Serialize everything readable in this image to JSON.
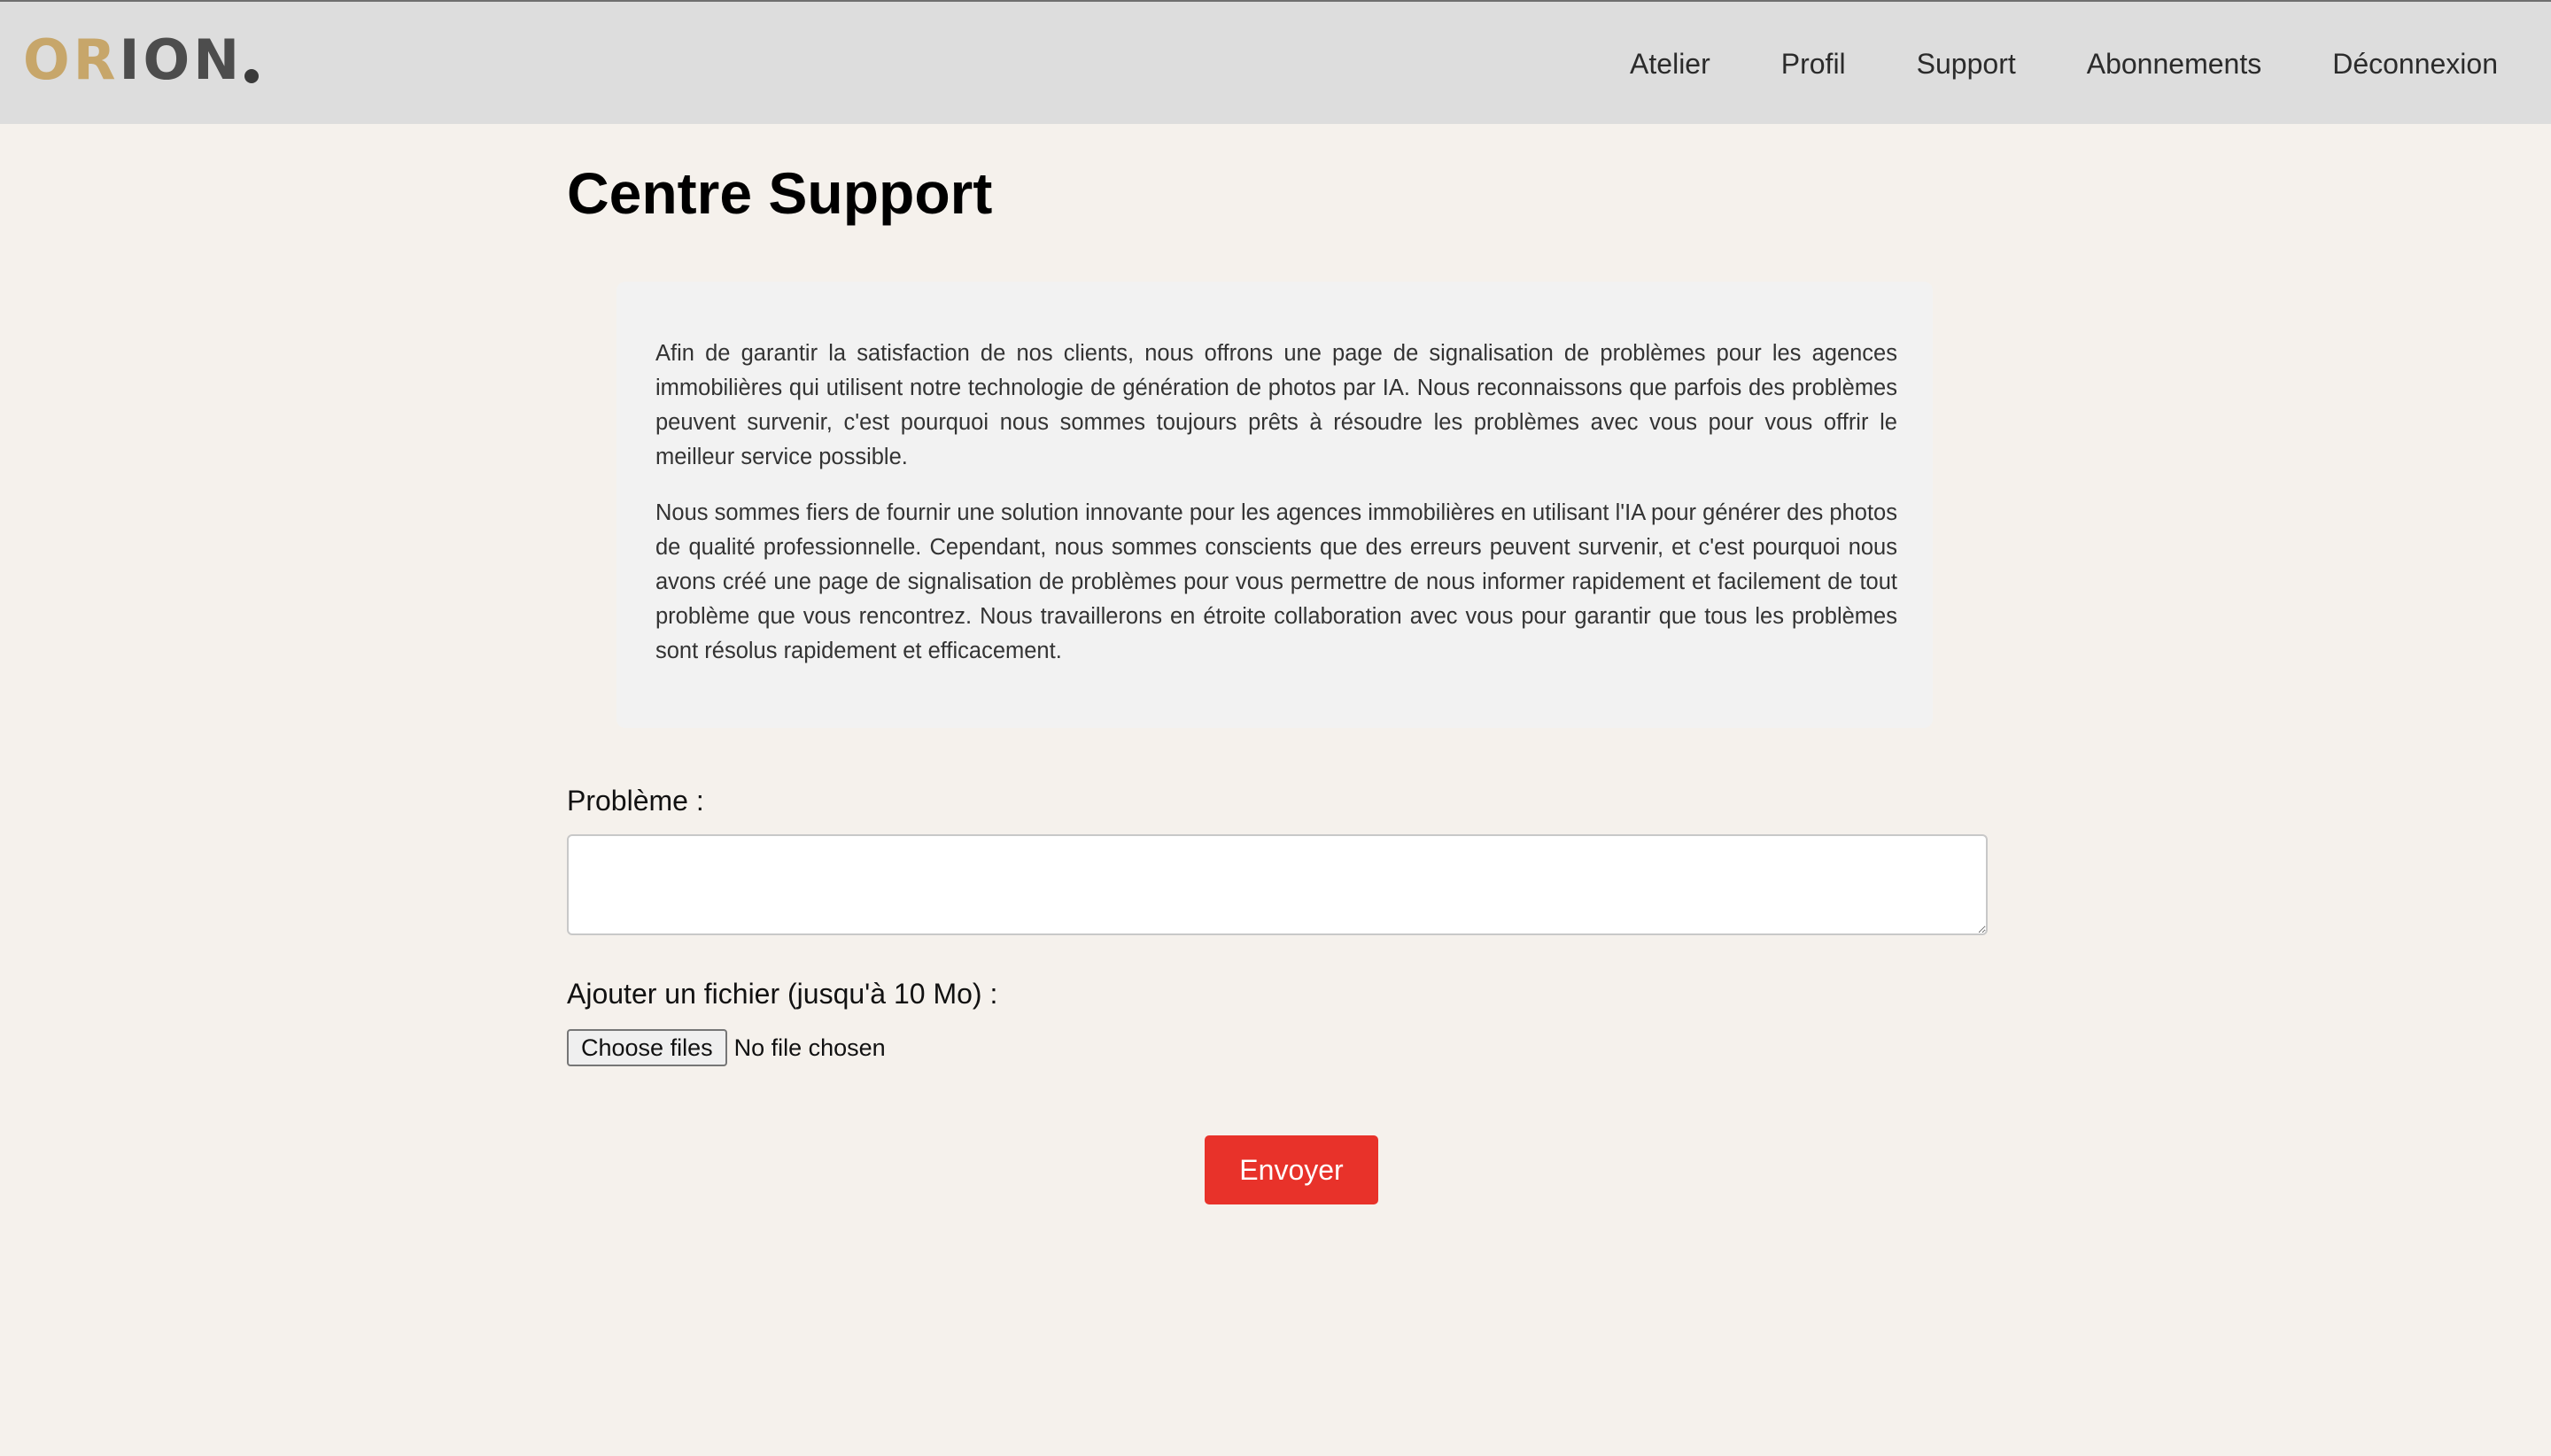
{
  "brand": {
    "logo_part1": "OR",
    "logo_part2": "ION",
    "accent_gold": "#c7a66a",
    "dark_gray": "#4d4d4d"
  },
  "nav": {
    "items": [
      {
        "label": "Atelier"
      },
      {
        "label": "Profil"
      },
      {
        "label": "Support"
      },
      {
        "label": "Abonnements"
      },
      {
        "label": "Déconnexion"
      }
    ]
  },
  "page": {
    "title": "Centre Support"
  },
  "intro": {
    "paragraph1": "Afin de garantir la satisfaction de nos clients, nous offrons une page de signalisation de problèmes pour les agences immobilières qui utilisent notre technologie de génération de photos par IA. Nous reconnaissons que parfois des problèmes peuvent survenir, c'est pourquoi nous sommes toujours prêts à résoudre les problèmes avec vous pour vous offrir le meilleur service possible.",
    "paragraph2": "Nous sommes fiers de fournir une solution innovante pour les agences immobilières en utilisant l'IA pour générer des photos de qualité professionnelle. Cependant, nous sommes conscients que des erreurs peuvent survenir, et c'est pourquoi nous avons créé une page de signalisation de problèmes pour vous permettre de nous informer rapidement et facilement de tout problème que vous rencontrez. Nous travaillerons en étroite collaboration avec vous pour garantir que tous les problèmes sont résolus rapidement et efficacement."
  },
  "form": {
    "problem_label": "Problème :",
    "problem_value": "",
    "file_label": "Ajouter un fichier (jusqu'à 10 Mo) :",
    "choose_files_label": "Choose files",
    "file_status": "No file chosen",
    "submit_label": "Envoyer",
    "submit_color": "#e8322a"
  }
}
